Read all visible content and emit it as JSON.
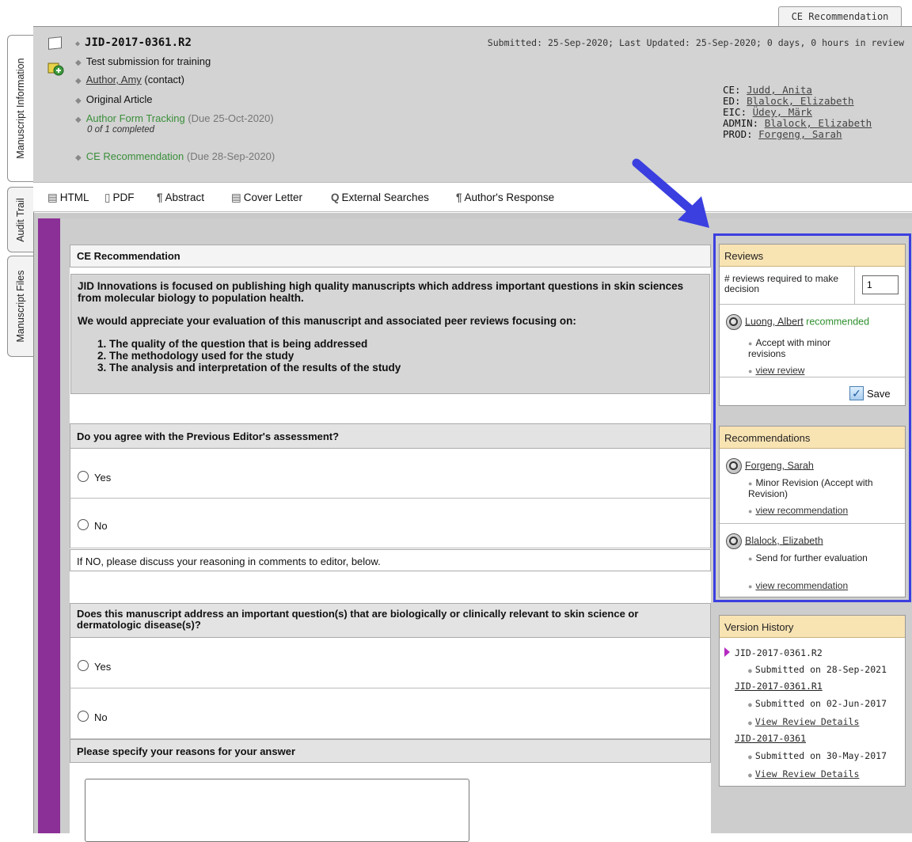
{
  "top_tab": "CE Recommendation",
  "side_tabs": [
    "Manuscript Information",
    "Audit Trail",
    "Manuscript Files"
  ],
  "header": {
    "manuscript_id": "JID-2017-0361.R2",
    "title": "Test submission for training",
    "author_name": "Author, Amy",
    "author_suffix": "(contact)",
    "article_type": "Original Article",
    "aft_label": "Author Form Tracking",
    "aft_due": "(Due 25-Oct-2020)",
    "aft_sub": "0 of 1 completed",
    "ce_label": "CE Recommendation",
    "ce_due": "(Due 28-Sep-2020)",
    "submitted_info": "Submitted: 25-Sep-2020; Last Updated: 25-Sep-2020; 0 days, 0 hours in review",
    "roles": [
      {
        "role": "CE:",
        "name": "Judd, Anita"
      },
      {
        "role": "ED:",
        "name": "Blalock, Elizabeth"
      },
      {
        "role": "EIC:",
        "name": "Üdey, Märk"
      },
      {
        "role": "ADMIN:",
        "name": "Blalock, Elizabeth"
      },
      {
        "role": "PROD:",
        "name": "Forgeng, Sarah"
      }
    ]
  },
  "toolbar": {
    "html": "HTML",
    "pdf": "PDF",
    "abstract": "Abstract",
    "cover_letter": "Cover Letter",
    "external_searches": "External Searches",
    "authors_response": "Author's Response"
  },
  "form": {
    "section_title": "CE Recommendation",
    "intro_p1": "JID Innovations is focused on publishing high quality manuscripts which address important questions in skin sciences from molecular biology to population health.",
    "intro_p2": "We would appreciate your evaluation of this manuscript and associated peer reviews focusing on:",
    "intro_items": [
      "The quality of the question that is being addressed",
      "The methodology used for the study",
      "The analysis and interpretation of the results of the study"
    ],
    "q1": "Do you agree with the Previous Editor's assessment?",
    "yes": "Yes",
    "no": "No",
    "q1_note": "If NO, please discuss your reasoning in comments to editor, below.",
    "q2": "Does this manuscript address an important question(s) that are biologically or clinically relevant to skin science or dermatologic disease(s)?",
    "q3": "Please specify your reasons for your answer",
    "reasons_value": ""
  },
  "reviews": {
    "title": "Reviews",
    "required_label": "# reviews required to make decision",
    "required_value": "1",
    "reviewer": "Luong, Albert",
    "reviewer_status": "recommended",
    "decision": "Accept with minor revisions",
    "view_link": "view review",
    "save": "Save"
  },
  "recommendations": {
    "title": "Recommendations",
    "items": [
      {
        "name": "Forgeng, Sarah",
        "decision": "Minor Revision (Accept with Revision)",
        "link": "view recommendation"
      },
      {
        "name": "Blalock, Elizabeth",
        "decision": "Send for further evaluation",
        "link": "view recommendation"
      }
    ]
  },
  "version_history": {
    "title": "Version History",
    "entries": [
      {
        "id": "JID-2017-0361.R2",
        "submitted": "Submitted on 28-Sep-2021"
      },
      {
        "id": "JID-2017-0361.R1",
        "submitted": "Submitted on 02-Jun-2017",
        "link": "View Review Details"
      },
      {
        "id": "JID-2017-0361",
        "submitted": "Submitted on 30-May-2017",
        "link": "View Review Details"
      }
    ]
  },
  "colors": {
    "purple_bar": "#8b3096",
    "panel_header": "#f8e3b3",
    "highlight": "#3b3fe0",
    "green_status": "#3a8f3a"
  }
}
